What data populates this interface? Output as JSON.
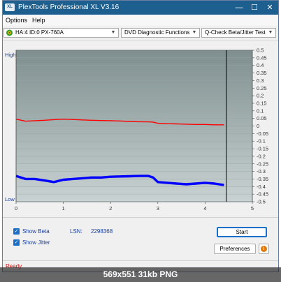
{
  "window": {
    "title": "PlexTools Professional XL V3.16",
    "app_icon_text": "XL",
    "minimize_glyph": "—",
    "maximize_glyph": "☐",
    "close_glyph": "✕"
  },
  "menu": {
    "options_label": "Options",
    "help_label": "Help"
  },
  "toolbar": {
    "drive_value": "HA:4 ID:0  PX-760A",
    "function_value": "DVD Diagnostic Functions",
    "test_value": "Q-Check Beta/Jitter Test"
  },
  "chart_data": {
    "type": "line",
    "left_axis_labels": [
      "High",
      "Low"
    ],
    "x_ticks": [
      0,
      1,
      2,
      3,
      4,
      5
    ],
    "xlim": [
      0,
      5
    ],
    "y_ticks": [
      0.5,
      0.45,
      0.4,
      0.35,
      0.3,
      0.25,
      0.2,
      0.15,
      0.1,
      0.05,
      0,
      -0.05,
      -0.1,
      -0.15,
      -0.2,
      -0.25,
      -0.3,
      -0.35,
      -0.4,
      -0.45,
      -0.5
    ],
    "ylim": [
      -0.5,
      0.5
    ],
    "end_marker_x": 4.45,
    "colors": {
      "beta": "#ff0000",
      "jitter": "#0000ff",
      "plot_top": "#7f8f8f",
      "plot_bottom": "#c9d2d2"
    },
    "series": [
      {
        "name": "Beta",
        "x": [
          0,
          0.2,
          0.4,
          0.6,
          0.8,
          1.0,
          1.2,
          1.4,
          1.6,
          1.8,
          2.0,
          2.2,
          2.4,
          2.6,
          2.8,
          2.9,
          3.0,
          3.2,
          3.4,
          3.6,
          3.8,
          4.0,
          4.2,
          4.4
        ],
        "values": [
          0.045,
          0.032,
          0.035,
          0.038,
          0.042,
          0.045,
          0.043,
          0.04,
          0.038,
          0.036,
          0.035,
          0.033,
          0.03,
          0.028,
          0.027,
          0.026,
          0.018,
          0.015,
          0.014,
          0.012,
          0.01,
          0.01,
          0.008,
          0.008
        ]
      },
      {
        "name": "Jitter",
        "x": [
          0,
          0.1,
          0.2,
          0.4,
          0.6,
          0.8,
          1.0,
          1.2,
          1.4,
          1.6,
          1.8,
          2.0,
          2.2,
          2.4,
          2.6,
          2.8,
          2.9,
          3.0,
          3.2,
          3.4,
          3.6,
          3.8,
          4.0,
          4.2,
          4.4
        ],
        "values": [
          -0.33,
          -0.34,
          -0.35,
          -0.35,
          -0.36,
          -0.37,
          -0.355,
          -0.35,
          -0.345,
          -0.34,
          -0.34,
          -0.335,
          -0.333,
          -0.332,
          -0.33,
          -0.33,
          -0.34,
          -0.37,
          -0.375,
          -0.38,
          -0.385,
          -0.38,
          -0.375,
          -0.38,
          -0.39
        ]
      }
    ]
  },
  "bottom": {
    "show_beta_label": "Show Beta",
    "show_jitter_label": "Show Jitter",
    "lsn_label": "LSN:",
    "lsn_value": "2298368",
    "start_label": "Start",
    "preferences_label": "Preferences",
    "info_glyph": "i",
    "check_glyph": "✓"
  },
  "status": {
    "text": "Ready"
  },
  "caption": {
    "text": "569x551  31kb  PNG"
  }
}
